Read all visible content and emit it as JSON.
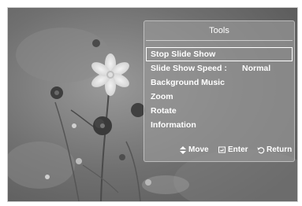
{
  "tools": {
    "title": "Tools",
    "items": [
      {
        "label": "Stop Slide Show",
        "value": ""
      },
      {
        "label": "Slide Show Speed :",
        "value": "Normal"
      },
      {
        "label": "Background Music",
        "value": ""
      },
      {
        "label": "Zoom",
        "value": ""
      },
      {
        "label": "Rotate",
        "value": ""
      },
      {
        "label": "Information",
        "value": ""
      }
    ],
    "selected_index": 0
  },
  "footer": {
    "move_label": "Move",
    "move_icon": "up-down-arrows-icon",
    "enter_label": "Enter",
    "enter_icon": "enter-icon",
    "return_label": "Return",
    "return_icon": "return-icon"
  },
  "colors": {
    "panel_bg": "#969696",
    "text": "#ffffff"
  }
}
